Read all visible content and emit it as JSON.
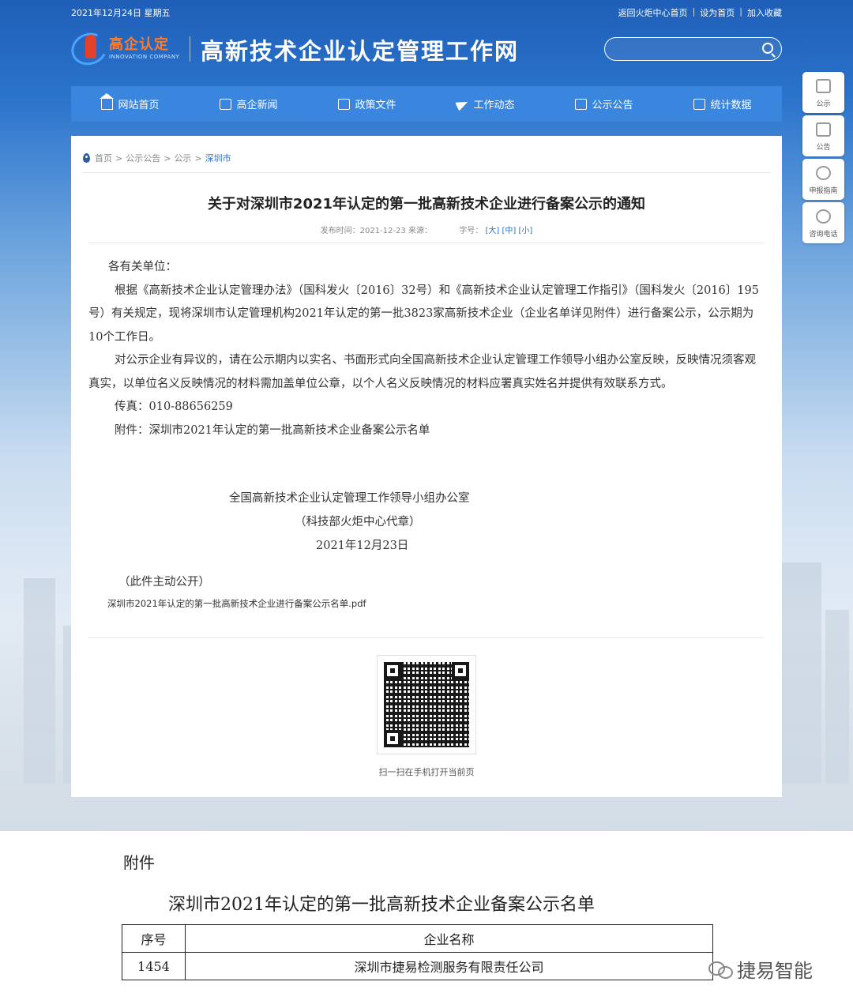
{
  "topbar": {
    "date": "2021年12月24日 星期五",
    "links": [
      "返回火炬中心首页",
      "设为首页",
      "加入收藏"
    ]
  },
  "header": {
    "logo_cn": "高企认定",
    "logo_en": "INNOVATION COMPANY",
    "site_title": "高新技术企业认定管理工作网",
    "search_placeholder": ""
  },
  "nav": {
    "items": [
      {
        "label": "网站首页",
        "icon": "home-icon"
      },
      {
        "label": "高企新闻",
        "icon": "news-icon"
      },
      {
        "label": "政策文件",
        "icon": "document-icon"
      },
      {
        "label": "工作动态",
        "icon": "paper-plane-icon"
      },
      {
        "label": "公示公告",
        "icon": "notice-icon"
      },
      {
        "label": "统计数据",
        "icon": "chart-icon"
      }
    ]
  },
  "side": {
    "items": [
      {
        "label": "公示",
        "icon": "notice-board-icon"
      },
      {
        "label": "公告",
        "icon": "announcement-icon"
      },
      {
        "label": "申报指南",
        "icon": "compass-icon"
      },
      {
        "label": "咨询电话",
        "icon": "phone-icon"
      }
    ]
  },
  "breadcrumb": {
    "items": [
      "首页",
      "公示公告",
      "公示"
    ],
    "current": "深圳市",
    "sep": ">"
  },
  "article": {
    "title": "关于对深圳市2021年认定的第一批高新技术企业进行备案公示的通知",
    "meta_prefix": "发布时间：2021-12-23 来源：",
    "meta_fontsize_label": "字号：",
    "font_large": "[大]",
    "font_medium": "[中]",
    "font_small": "[小]",
    "salutation": "各有关单位：",
    "para1": "根据《高新技术企业认定管理办法》（国科发火〔2016〕32号）和《高新技术企业认定管理工作指引》（国科发火〔2016〕195号）有关规定，现将深圳市认定管理机构2021年认定的第一批3823家高新技术企业（企业名单详见附件）进行备案公示，公示期为10个工作日。",
    "para2": "对公示企业有异议的，请在公示期内以实名、书面形式向全国高新技术企业认定管理工作领导小组办公室反映，反映情况须客观真实，以单位名义反映情况的材料需加盖单位公章，以个人名义反映情况的材料应署真实姓名并提供有效联系方式。",
    "fax": "传真：010-88656259",
    "attachment": "附件：深圳市2021年认定的第一批高新技术企业备案公示名单",
    "sig_org": "全国高新技术企业认定管理工作领导小组办公室",
    "sig_seal": "（科技部火炬中心代章）",
    "sig_date": "2021年12月23日",
    "public_note": "（此件主动公开）",
    "pdf_link": "深圳市2021年认定的第一批高新技术企业进行备案公示名单.pdf",
    "qr_caption": "扫一扫在手机打开当前页"
  },
  "attachment_doc": {
    "label": "附件",
    "title": "深圳市2021年认定的第一批高新技术企业备案公示名单",
    "headers": [
      "序号",
      "企业名称"
    ],
    "rows": [
      [
        "1454",
        "深圳市捷易检测服务有限责任公司"
      ]
    ]
  },
  "watermark": {
    "text": "捷易智能"
  }
}
